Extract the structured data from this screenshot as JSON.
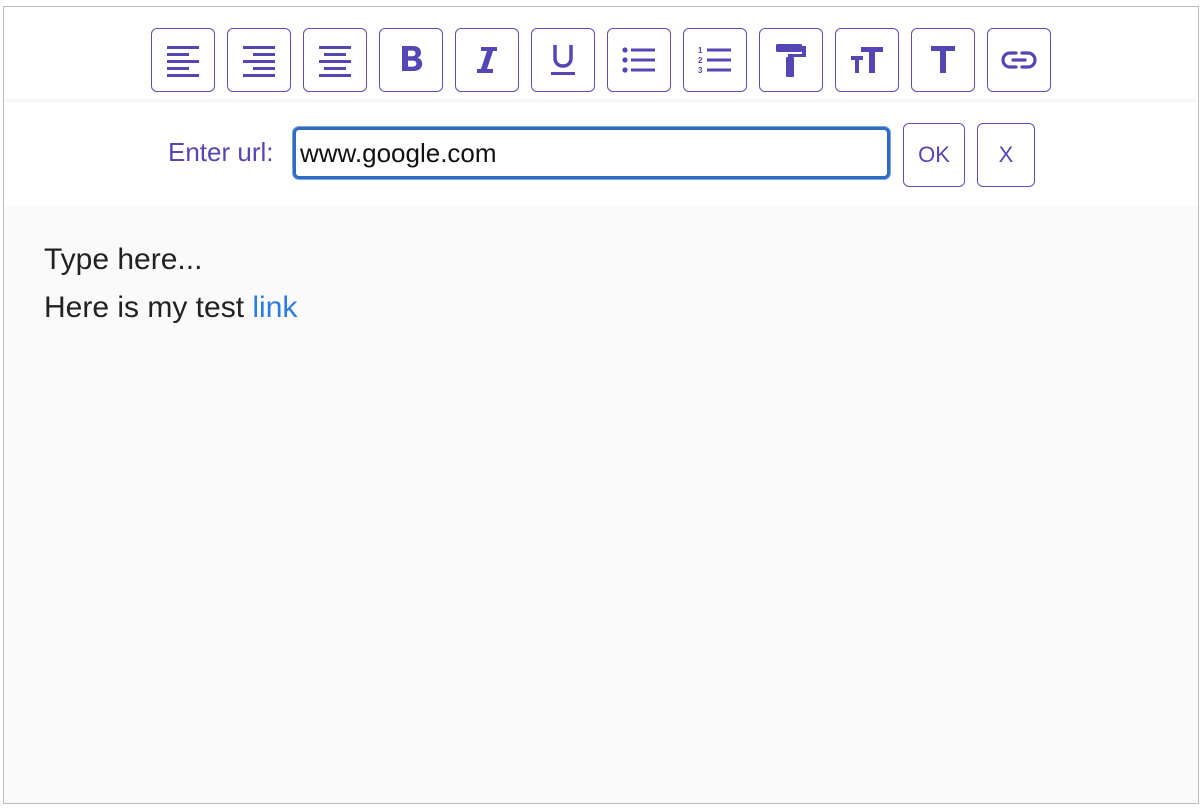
{
  "toolbar": {
    "buttons": [
      {
        "name": "align-left",
        "icon": "align-left-icon"
      },
      {
        "name": "align-right",
        "icon": "align-right-icon"
      },
      {
        "name": "align-center",
        "icon": "align-center-icon"
      },
      {
        "name": "bold",
        "icon": "bold-icon",
        "glyph": "B"
      },
      {
        "name": "italic",
        "icon": "italic-icon",
        "glyph": "I"
      },
      {
        "name": "underline",
        "icon": "underline-icon",
        "glyph": "U"
      },
      {
        "name": "bullet-list",
        "icon": "bullet-list-icon"
      },
      {
        "name": "numbered-list",
        "icon": "numbered-list-icon"
      },
      {
        "name": "paint-format",
        "icon": "paint-roller-icon"
      },
      {
        "name": "font-size",
        "icon": "font-size-icon"
      },
      {
        "name": "text",
        "icon": "text-icon",
        "glyph": "T"
      },
      {
        "name": "link",
        "icon": "link-icon"
      }
    ]
  },
  "link_bar": {
    "label": "Enter url:",
    "url_value": "www.google.com",
    "ok_label": "OK",
    "cancel_label": "X"
  },
  "editor": {
    "line1": "Type here...",
    "line2_prefix": "Here is my test ",
    "line2_link": "link"
  },
  "colors": {
    "accent": "#5546b5",
    "link": "#2c7be5",
    "input_focus": "#2f6bc2"
  }
}
